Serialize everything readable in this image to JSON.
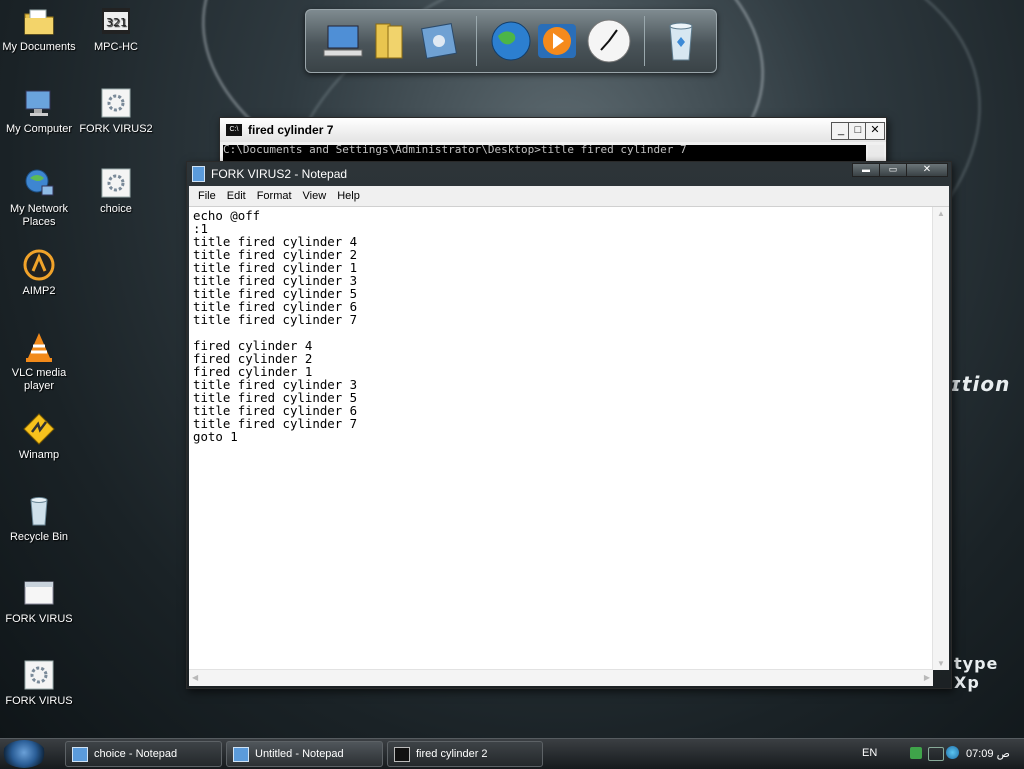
{
  "desktop": {
    "icons": [
      {
        "label": "My Documents",
        "icon": "folder-documents-icon"
      },
      {
        "label": "MPC-HC",
        "icon": "mpc-hc-icon"
      },
      {
        "label": "My Computer",
        "icon": "computer-icon"
      },
      {
        "label": "FORK VIRUS2",
        "icon": "batch-file-icon"
      },
      {
        "label": "My Network Places",
        "icon": "network-places-icon"
      },
      {
        "label": "choice",
        "icon": "batch-file-icon"
      },
      {
        "label": "AIMP2",
        "icon": "aimp-icon"
      },
      {
        "label": "VLC media player",
        "icon": "vlc-icon"
      },
      {
        "label": "Winamp",
        "icon": "winamp-icon"
      },
      {
        "label": "Recycle Bin",
        "icon": "recycle-bin-icon"
      },
      {
        "label": "FORK VIRUS",
        "icon": "window-app-icon"
      },
      {
        "label": "FORK VIRUS",
        "icon": "batch-file-icon"
      }
    ],
    "watermark_top": "ɪtion",
    "watermark_bottom": "type Xp"
  },
  "dock": {
    "items": [
      "computer-icon",
      "folder-icon",
      "control-panel-icon",
      "globe-icon",
      "media-player-icon",
      "clock-icon",
      "recycle-bin-icon"
    ]
  },
  "cmd_window": {
    "title": "fired cylinder 7",
    "partial_line": "C:\\Documents and Settings\\Administrator\\Desktop>title fired cylinder 7",
    "buttons": {
      "minimize": "_",
      "maximize": "□",
      "close": "✕"
    }
  },
  "notepad": {
    "title": "FORK VIRUS2 - Notepad",
    "menu": [
      "File",
      "Edit",
      "Format",
      "View",
      "Help"
    ],
    "lines": [
      "echo @off",
      ":1",
      "title fired cylinder 4",
      "title fired cylinder 2",
      "title fired cylinder 1",
      "title fired cylinder 3",
      "title fired cylinder 5",
      "title fired cylinder 6",
      "title fired cylinder 7",
      "",
      "fired cylinder 4",
      "fired cylinder 2",
      "fired cylinder 1",
      "title fired cylinder 3",
      "title fired cylinder 5",
      "title fired cylinder 6",
      "title fired cylinder 7",
      "goto 1"
    ],
    "buttons": {
      "minimize": "▬",
      "maximize": "▭",
      "close": "✕"
    }
  },
  "taskbar": {
    "tasks": [
      {
        "label": "choice - Notepad",
        "icon": "notepad-icon",
        "active": false
      },
      {
        "label": "Untitled - Notepad",
        "icon": "notepad-icon",
        "active": true
      },
      {
        "label": "fired cylinder 2",
        "icon": "cmd-icon",
        "active": false
      }
    ],
    "language": "EN",
    "clock": "07:09 ص"
  }
}
